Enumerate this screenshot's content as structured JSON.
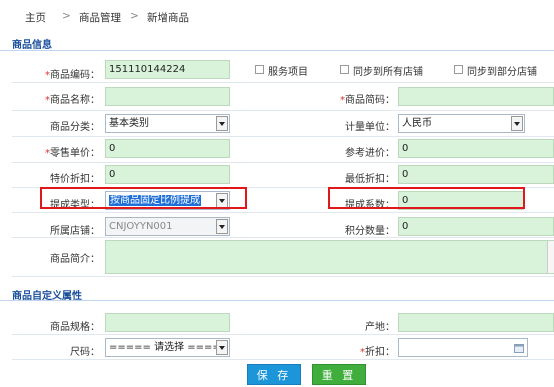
{
  "breadcrumb": {
    "home": "主页",
    "sep1": ">",
    "level1": "商品管理",
    "sep2": ">",
    "current": "新增商品"
  },
  "section_info": {
    "title": "商品信息"
  },
  "section_custom": {
    "title": "商品自定义属性"
  },
  "form": {
    "code_label": "商品编码：",
    "code_value": "151110144224",
    "service_item_label": "服务项目",
    "sync_all_label": "同步到所有店铺",
    "sync_some_label": "同步到部分店铺",
    "name_label": "商品名称：",
    "name_value": "",
    "short_name_label": "商品简码：",
    "short_name_value": "",
    "category_label": "商品分类：",
    "category_value": "基本类别",
    "unit_label": "计量单位：",
    "unit_value": "人民币",
    "retail_price_label": "零售单价：",
    "retail_price_value": "0",
    "ref_cost_label": "参考进价：",
    "ref_cost_value": "0",
    "special_discount_label": "特价折扣：",
    "special_discount_value": "0",
    "min_discount_label": "最低折扣：",
    "min_discount_value": "0",
    "commission_type_label": "提成类型：",
    "commission_type_value": "按商品固定比例提成",
    "commission_rate_label": "提成系数：",
    "commission_rate_value": "0",
    "store_label": "所属店铺：",
    "store_value": "CNJOYYN001",
    "points_label": "积分数量：",
    "points_value": "0",
    "intro_label": "商品简介：",
    "intro_value": "",
    "spec_label": "商品规格：",
    "spec_value": "",
    "origin_label": "产地：",
    "origin_value": "",
    "size_label": "尺码：",
    "size_value": "===== 请选择 =====",
    "discount_label": "折扣：",
    "discount_value": ""
  },
  "required_marker": "*",
  "buttons": {
    "save": "保 存",
    "reset": "重 置"
  },
  "colors": {
    "field_bg": "#d9f2da",
    "highlight": "#e0181c",
    "save": "#1c96d8",
    "reset": "#3fae3c",
    "section_title": "#1a4f9c"
  }
}
